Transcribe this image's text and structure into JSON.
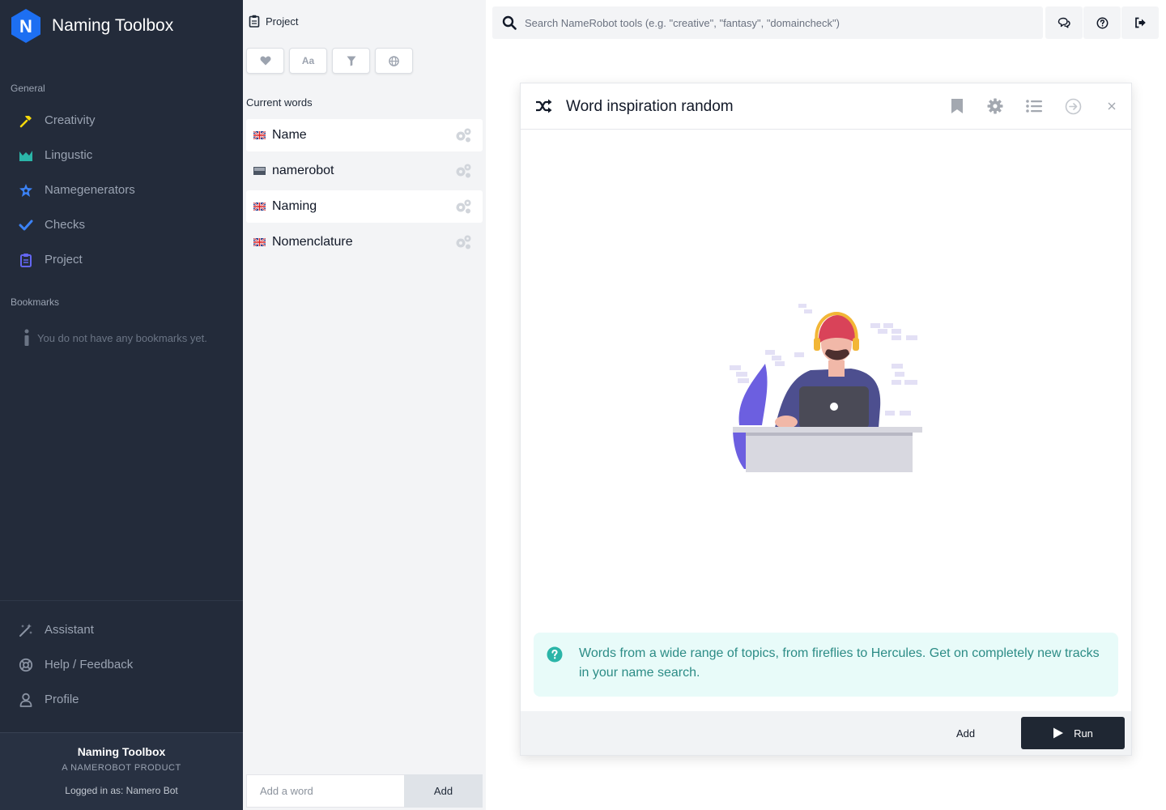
{
  "sidebar": {
    "app_title": "Naming Toolbox",
    "logo_letter": "N",
    "general_label": "General",
    "nav": [
      {
        "label": "Creativity",
        "icon": "hammer-icon",
        "color": "#f5d90a"
      },
      {
        "label": "Lingustic",
        "icon": "chart-icon",
        "color": "#2bb5a8"
      },
      {
        "label": "Namegenerators",
        "icon": "star-badge-icon",
        "color": "#3b82f6"
      },
      {
        "label": "Checks",
        "icon": "check-icon",
        "color": "#3b82f6"
      },
      {
        "label": "Project",
        "icon": "clipboard-icon",
        "color": "#6366f1"
      }
    ],
    "bookmarks_label": "Bookmarks",
    "bookmarks_empty": "You do not have any bookmarks yet.",
    "bottom_nav": [
      {
        "label": "Assistant",
        "icon": "magic-wand-icon"
      },
      {
        "label": "Help / Feedback",
        "icon": "lifebuoy-icon"
      },
      {
        "label": "Profile",
        "icon": "user-icon"
      }
    ],
    "footer": {
      "title": "Naming Toolbox",
      "subtitle": "A NAMEROBOT PRODUCT",
      "logged_in": "Logged in as: Namero Bot"
    }
  },
  "project": {
    "title": "Project",
    "filters": [
      {
        "name": "heart-icon"
      },
      {
        "name": "font-case-icon",
        "label": "Aa"
      },
      {
        "name": "filter-icon"
      },
      {
        "name": "globe-icon"
      }
    ],
    "current_words_label": "Current words",
    "words": [
      {
        "text": "Name",
        "flag": "uk",
        "highlighted": true
      },
      {
        "text": "namerobot",
        "flag": "generic",
        "highlighted": false
      },
      {
        "text": "Naming",
        "flag": "uk",
        "highlighted": true
      },
      {
        "text": "Nomenclature",
        "flag": "uk",
        "highlighted": false
      }
    ],
    "add_word_placeholder": "Add a word",
    "add_button": "Add"
  },
  "topbar": {
    "search_placeholder": "Search NameRobot tools (e.g. \"creative\", \"fantasy\", \"domaincheck\")",
    "buttons": [
      "chat-icon",
      "help-circle-icon",
      "logout-icon"
    ]
  },
  "tool": {
    "title": "Word inspiration random",
    "info_text": "Words from a wide range of topics, from fireflies to Hercules. Get on completely new tracks in your name search.",
    "add_label": "Add",
    "run_label": "Run"
  },
  "colors": {
    "sidebar_bg": "#232b3a",
    "accent_blue": "#1d6ff2",
    "info_bg": "#e8fbf9",
    "info_text": "#2c8c86",
    "run_bg": "#1f2733"
  }
}
